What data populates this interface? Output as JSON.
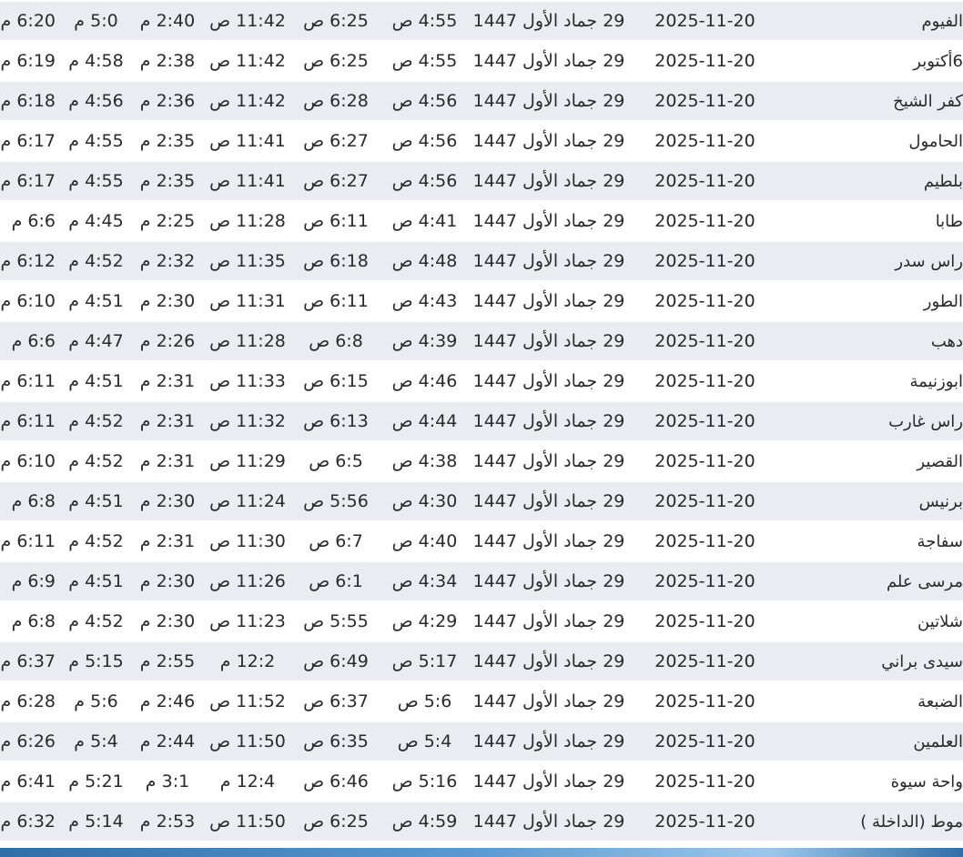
{
  "table": {
    "rows": [
      {
        "city": "الفيوم",
        "greg": "2025-11-20",
        "hijri": "29 جماد الأول 1447",
        "fajr": "4:55 ص",
        "sunrise": "6:25 ص",
        "dhuhr": "11:42 ص",
        "asr": "2:40 م",
        "maghrib": "5:0 م",
        "isha": "6:20 م"
      },
      {
        "city": "6أكتوبر",
        "greg": "2025-11-20",
        "hijri": "29 جماد الأول 1447",
        "fajr": "4:55 ص",
        "sunrise": "6:25 ص",
        "dhuhr": "11:42 ص",
        "asr": "2:38 م",
        "maghrib": "4:58 م",
        "isha": "6:19 م"
      },
      {
        "city": "كفر الشيخ",
        "greg": "2025-11-20",
        "hijri": "29 جماد الأول 1447",
        "fajr": "4:56 ص",
        "sunrise": "6:28 ص",
        "dhuhr": "11:42 ص",
        "asr": "2:36 م",
        "maghrib": "4:56 م",
        "isha": "6:18 م"
      },
      {
        "city": "الحامول",
        "greg": "2025-11-20",
        "hijri": "29 جماد الأول 1447",
        "fajr": "4:56 ص",
        "sunrise": "6:27 ص",
        "dhuhr": "11:41 ص",
        "asr": "2:35 م",
        "maghrib": "4:55 م",
        "isha": "6:17 م"
      },
      {
        "city": "بلطيم",
        "greg": "2025-11-20",
        "hijri": "29 جماد الأول 1447",
        "fajr": "4:56 ص",
        "sunrise": "6:27 ص",
        "dhuhr": "11:41 ص",
        "asr": "2:35 م",
        "maghrib": "4:55 م",
        "isha": "6:17 م"
      },
      {
        "city": "طابا",
        "greg": "2025-11-20",
        "hijri": "29 جماد الأول 1447",
        "fajr": "4:41 ص",
        "sunrise": "6:11 ص",
        "dhuhr": "11:28 ص",
        "asr": "2:25 م",
        "maghrib": "4:45 م",
        "isha": "6:6 م"
      },
      {
        "city": "راس سدر",
        "greg": "2025-11-20",
        "hijri": "29 جماد الأول 1447",
        "fajr": "4:48 ص",
        "sunrise": "6:18 ص",
        "dhuhr": "11:35 ص",
        "asr": "2:32 م",
        "maghrib": "4:52 م",
        "isha": "6:12 م"
      },
      {
        "city": "الطور",
        "greg": "2025-11-20",
        "hijri": "29 جماد الأول 1447",
        "fajr": "4:43 ص",
        "sunrise": "6:11 ص",
        "dhuhr": "11:31 ص",
        "asr": "2:30 م",
        "maghrib": "4:51 م",
        "isha": "6:10 م"
      },
      {
        "city": "دهب",
        "greg": "2025-11-20",
        "hijri": "29 جماد الأول 1447",
        "fajr": "4:39 ص",
        "sunrise": "6:8 ص",
        "dhuhr": "11:28 ص",
        "asr": "2:26 م",
        "maghrib": "4:47 م",
        "isha": "6:6 م"
      },
      {
        "city": "ابوزنيمة",
        "greg": "2025-11-20",
        "hijri": "29 جماد الأول 1447",
        "fajr": "4:46 ص",
        "sunrise": "6:15 ص",
        "dhuhr": "11:33 ص",
        "asr": "2:31 م",
        "maghrib": "4:51 م",
        "isha": "6:11 م"
      },
      {
        "city": "راس غارب",
        "greg": "2025-11-20",
        "hijri": "29 جماد الأول 1447",
        "fajr": "4:44 ص",
        "sunrise": "6:13 ص",
        "dhuhr": "11:32 ص",
        "asr": "2:31 م",
        "maghrib": "4:52 م",
        "isha": "6:11 م"
      },
      {
        "city": "القصير",
        "greg": "2025-11-20",
        "hijri": "29 جماد الأول 1447",
        "fajr": "4:38 ص",
        "sunrise": "6:5 ص",
        "dhuhr": "11:29 ص",
        "asr": "2:31 م",
        "maghrib": "4:52 م",
        "isha": "6:10 م"
      },
      {
        "city": "برنيس",
        "greg": "2025-11-20",
        "hijri": "29 جماد الأول 1447",
        "fajr": "4:30 ص",
        "sunrise": "5:56 ص",
        "dhuhr": "11:24 ص",
        "asr": "2:30 م",
        "maghrib": "4:51 م",
        "isha": "6:8 م"
      },
      {
        "city": "سفاجة",
        "greg": "2025-11-20",
        "hijri": "29 جماد الأول 1447",
        "fajr": "4:40 ص",
        "sunrise": "6:7 ص",
        "dhuhr": "11:30 ص",
        "asr": "2:31 م",
        "maghrib": "4:52 م",
        "isha": "6:11 م"
      },
      {
        "city": "مرسى علم",
        "greg": "2025-11-20",
        "hijri": "29 جماد الأول 1447",
        "fajr": "4:34 ص",
        "sunrise": "6:1 ص",
        "dhuhr": "11:26 ص",
        "asr": "2:30 م",
        "maghrib": "4:51 م",
        "isha": "6:9 م"
      },
      {
        "city": "شلاتين",
        "greg": "2025-11-20",
        "hijri": "29 جماد الأول 1447",
        "fajr": "4:29 ص",
        "sunrise": "5:55 ص",
        "dhuhr": "11:23 ص",
        "asr": "2:30 م",
        "maghrib": "4:52 م",
        "isha": "6:8 م"
      },
      {
        "city": "سيدى براني",
        "greg": "2025-11-20",
        "hijri": "29 جماد الأول 1447",
        "fajr": "5:17 ص",
        "sunrise": "6:49 ص",
        "dhuhr": "12:2 م",
        "asr": "2:55 م",
        "maghrib": "5:15 م",
        "isha": "6:37 م"
      },
      {
        "city": "الضبعة",
        "greg": "2025-11-20",
        "hijri": "29 جماد الأول 1447",
        "fajr": "5:6 ص",
        "sunrise": "6:37 ص",
        "dhuhr": "11:52 ص",
        "asr": "2:46 م",
        "maghrib": "5:6 م",
        "isha": "6:28 م"
      },
      {
        "city": "العلمين",
        "greg": "2025-11-20",
        "hijri": "29 جماد الأول 1447",
        "fajr": "5:4 ص",
        "sunrise": "6:35 ص",
        "dhuhr": "11:50 ص",
        "asr": "2:44 م",
        "maghrib": "5:4 م",
        "isha": "6:26 م"
      },
      {
        "city": "واحة سيوة",
        "greg": "2025-11-20",
        "hijri": "29 جماد الأول 1447",
        "fajr": "5:16 ص",
        "sunrise": "6:46 ص",
        "dhuhr": "12:4 م",
        "asr": "3:1 م",
        "maghrib": "5:21 م",
        "isha": "6:41 م"
      },
      {
        "city": "موط (الداخلة )",
        "greg": "2025-11-20",
        "hijri": "29 جماد الأول 1447",
        "fajr": "4:59 ص",
        "sunrise": "6:25 ص",
        "dhuhr": "11:50 ص",
        "asr": "2:53 م",
        "maghrib": "5:14 م",
        "isha": "6:32 م"
      }
    ]
  }
}
